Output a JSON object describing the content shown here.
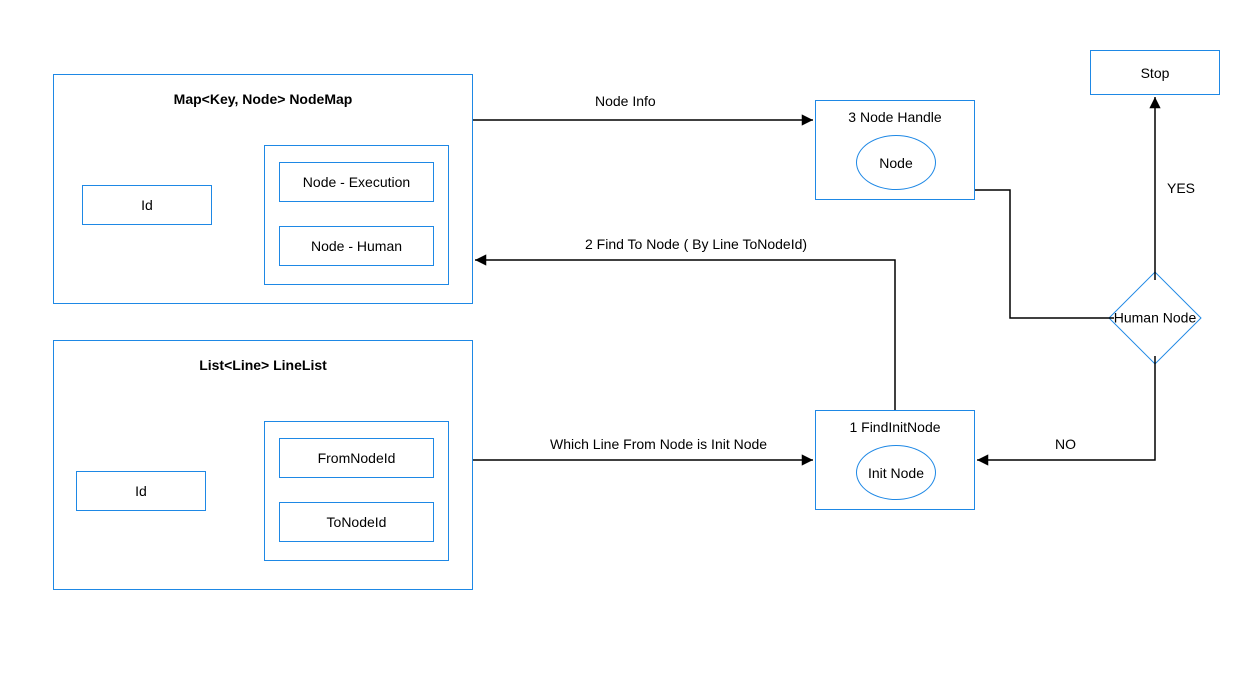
{
  "nodemap": {
    "title": "Map<Key, Node> NodeMap",
    "id_label": "Id",
    "items": [
      "Node - Execution",
      "Node - Human"
    ]
  },
  "linelist": {
    "title": "List<Line> LineList",
    "id_label": "Id",
    "items": [
      "FromNodeId",
      "ToNodeId"
    ]
  },
  "nodeHandle": {
    "title": "3 Node Handle",
    "ellipse": "Node"
  },
  "findInit": {
    "title": "1 FindInitNode",
    "ellipse": "Init Node"
  },
  "decision": {
    "label": "Human Node"
  },
  "stop": {
    "label": "Stop"
  },
  "edges": {
    "nodeInfo": "Node Info",
    "findToNode": "2 Find To Node ( By Line ToNodeId)",
    "whichLine": "Which Line From Node is Init Node",
    "yes": "YES",
    "no": "NO"
  }
}
